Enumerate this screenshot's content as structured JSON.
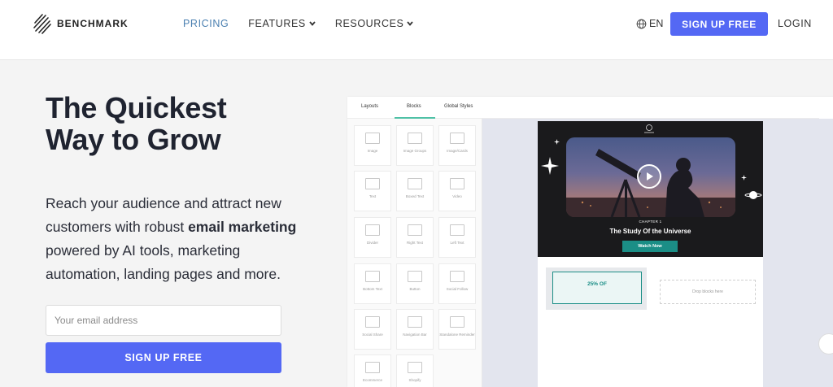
{
  "header": {
    "logo_text": "BENCHMARK",
    "nav": [
      {
        "label": "PRICING",
        "active": true,
        "dropdown": false
      },
      {
        "label": "FEATURES",
        "active": false,
        "dropdown": true
      },
      {
        "label": "RESOURCES",
        "active": false,
        "dropdown": true
      }
    ],
    "lang": "EN",
    "signup": "SIGN UP FREE",
    "login": "LOGIN"
  },
  "hero": {
    "title_line1": "The Quickest",
    "title_line2": "Way to Grow",
    "desc_part1": "Reach your audience and attract new customers with robust ",
    "desc_bold": "email marketing",
    "desc_part2": " powered by AI tools, marketing automation, landing pages and more.",
    "email_placeholder": "Your email address",
    "signup": "SIGN UP FREE"
  },
  "editor": {
    "tabs": [
      {
        "label": "Layouts"
      },
      {
        "label": "Blocks",
        "active": true
      },
      {
        "label": "Global Styles"
      }
    ],
    "blocks": [
      {
        "label": "Image"
      },
      {
        "label": "Image Groups"
      },
      {
        "label": "Image/Cards"
      },
      {
        "label": "Text"
      },
      {
        "label": "Boxed Text"
      },
      {
        "label": "Video"
      },
      {
        "label": "Divider"
      },
      {
        "label": "Right Text"
      },
      {
        "label": "Left Text"
      },
      {
        "label": "Bottom Text"
      },
      {
        "label": "Button"
      },
      {
        "label": "Social Follow"
      },
      {
        "label": "Social Share"
      },
      {
        "label": "Navigation Bar"
      },
      {
        "label": "Standalone Reminder"
      },
      {
        "label": "Ecommerce"
      },
      {
        "label": "Shopify"
      }
    ],
    "email": {
      "chapter": "CHAPTER 1",
      "title": "The Study Of the Universe",
      "button": "Watch Now",
      "coupon": "25% OF",
      "dropzone": "Drop blocks here"
    }
  },
  "colors": {
    "primary": "#5468f4",
    "accent_teal": "#1b8e86",
    "nav_active": "#4a7fb0"
  }
}
